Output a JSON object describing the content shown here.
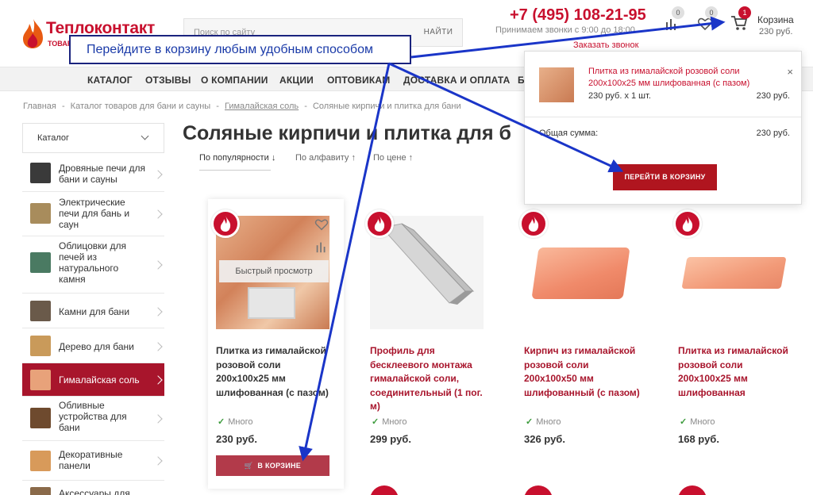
{
  "header": {
    "logo_title": "Теплоконтакт",
    "logo_subtitle": "ТОВАРЫ ДЛЯ БАНИ И САУНЫ",
    "search_placeholder": "Поиск по сайту",
    "search_button": "НАЙТИ",
    "phone": "+7 (495) 108-21-95",
    "calls_note": "Принимаем звонки с 9:00 до 18:00",
    "callback": "Заказать звонок",
    "compare_count": "0",
    "wishlist_count": "0",
    "cart_count": "1",
    "cart_label": "Корзина",
    "cart_total": "230 руб."
  },
  "nav": [
    "КАТАЛОГ",
    "ОТЗЫВЫ",
    "О КОМПАНИИ",
    "АКЦИИ",
    "ОПТОВИКАМ",
    "ДОСТАВКА И ОПЛАТА",
    "Б"
  ],
  "breadcrumbs": [
    "Главная",
    "-",
    "Каталог товаров для бани и сауны",
    "-",
    "Гималайская соль",
    "-",
    "Соляные кирпичи и плитка для бани"
  ],
  "sidebar": {
    "header": "Каталог",
    "items": [
      {
        "label": "Дровяные печи для бани и сауны",
        "icon": "stove-icon"
      },
      {
        "label": "Электрические печи для бань и саун",
        "icon": "electric-stove-icon"
      },
      {
        "label": "Облицовки для печей из натурального камня",
        "icon": "stone-cladding-icon"
      },
      {
        "label": "Камни для бани",
        "icon": "stones-icon"
      },
      {
        "label": "Дерево для бани",
        "icon": "wood-icon"
      },
      {
        "label": "Гималайская соль",
        "icon": "salt-icon",
        "active": true
      },
      {
        "label": "Обливные устройства для бани",
        "icon": "bucket-icon"
      },
      {
        "label": "Декоративные панели",
        "icon": "panel-icon"
      },
      {
        "label": "Аксессуары для",
        "icon": "accessory-icon"
      }
    ]
  },
  "main": {
    "title": "Соляные кирпичи и плитка для б",
    "sort": [
      {
        "label": "По популярности",
        "arrow": "↓",
        "active": true
      },
      {
        "label": "По алфавиту",
        "arrow": "↑"
      },
      {
        "label": "По цене",
        "arrow": "↑"
      }
    ],
    "quick_view": "Быстрый просмотр",
    "in_cart_button": "В КОРЗИНЕ",
    "products": [
      {
        "title": "Плитка из гималайской розовой соли 200х100х25 мм шлифованная (с пазом)",
        "stock": "Много",
        "price": "230 руб."
      },
      {
        "title": "Профиль для бесклеевого монтажа гималайской соли, соединительный (1 пог. м)",
        "stock": "Много",
        "price": "299 руб."
      },
      {
        "title": "Кирпич из гималайской розовой соли 200х100х50 мм шлифованный (с пазом)",
        "stock": "Много",
        "price": "326 руб."
      },
      {
        "title": "Плитка из гималайской розовой соли 200х100х25 мм шлифованная",
        "stock": "Много",
        "price": "168 руб."
      }
    ]
  },
  "cart_popup": {
    "item_name": "Плитка из гималайской розовой соли 200х100х25 мм шлифованная (с пазом)",
    "item_qty": "230 руб. х 1 шт.",
    "item_sum": "230 руб.",
    "close": "×",
    "total_label": "Общая сумма:",
    "total": "230 руб.",
    "checkout_button": "ПЕРЕЙТИ В КОРЗИНУ"
  },
  "annotation": "Перейдите в корзину любым удобным способом",
  "colors": {
    "brand": "#c8102e",
    "active_sidebar": "#a8152c",
    "annotation": "#1a3aa8"
  }
}
